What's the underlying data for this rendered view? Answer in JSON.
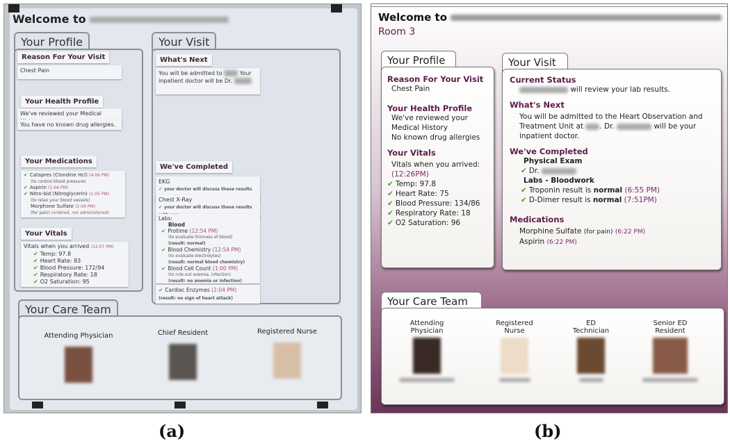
{
  "panel_a": {
    "label": "(a)",
    "welcome": "Welcome to",
    "profile": {
      "tab": "Your Profile",
      "reason_head": "Reason For Your Visit",
      "reason": "Chest Pain",
      "health_head": "Your Health Profile",
      "health": [
        "We've reviewed your Medical History.",
        "You have no known drug allergies."
      ],
      "meds_head": "Your Medications",
      "meds": [
        {
          "name": "Catapres (Clondine Hcl)",
          "time": "(4:06 PM)",
          "note": "(to control blood pressure)",
          "check": true
        },
        {
          "name": "Aspirin",
          "time": "(1:04 PM)",
          "note": "",
          "check": true
        },
        {
          "name": "Nitro-bid (Nitroglycerin)",
          "time": "(1:05 PM)",
          "note": "(to relax your blood vessels)",
          "check": true
        },
        {
          "name": "Morphone Sulfate",
          "time": "(1:04 PM)",
          "note": "(for pain)",
          "status": "(ordered, not administered)",
          "check": false
        }
      ],
      "vitals_head": "Your Vitals",
      "vitals_intro": "Vitals when you arrived",
      "vitals_time": "(12:07 PM)",
      "vitals": [
        "Temp: 97.8",
        "Heart Rate: 83",
        "Blood Pressure: 172/94",
        "Respiratory Rate: 18",
        "O2 Saturation: 95"
      ]
    },
    "visit": {
      "tab": "Your Visit",
      "next_head": "What's Next",
      "next_a": "You will be admitted to",
      "next_b": "Your",
      "next_c": "inpatient doctor will be Dr.",
      "completed_head": "We've Completed",
      "ekg": "EKG",
      "ekg_note": "your doctor will discuss these results with you",
      "xray": "Chest X-Ray",
      "xray_note": "your doctor will discuss these results with you",
      "labs": "Labs:",
      "blood": "Blood",
      "tests": [
        {
          "name": "Protime",
          "time": "(12:54 PM)",
          "note": "(to evaluate thinness of blood)",
          "result": "(result: normal)"
        },
        {
          "name": "Blood Chemistry",
          "time": "(12:54 PM)",
          "note": "(to evaluate electrolytes)",
          "result": "(result: normal blood chemistry)"
        },
        {
          "name": "Blood Cell Count",
          "time": "(1:00 PM)",
          "note": "(to rule out anemia, infection)",
          "result": "(result: no anemia or infection)"
        },
        {
          "name": "Cardiac Enzymes",
          "time": "(2:04 PM)",
          "note": "",
          "result": "(result: no sign of heart attack)"
        }
      ]
    },
    "care_team": {
      "tab": "Your Care Team",
      "roles": [
        "Attending Physician",
        "Chief Resident",
        "Registered Nurse"
      ]
    }
  },
  "panel_b": {
    "label": "(b)",
    "welcome": "Welcome to",
    "room": "Room 3",
    "profile": {
      "tab": "Your Profile",
      "reason_head": "Reason For Your Visit",
      "reason": "Chest Pain",
      "health_head": "Your Health Profile",
      "health_1": "We've reviewed your",
      "health_2": "Medical History",
      "health_3": "No known drug allergies",
      "vitals_head": "Your Vitals",
      "vitals_intro": "Vitals when you arrived:",
      "vitals_time": "(12:26PM)",
      "vitals": [
        "Temp: 97.8",
        "Heart Rate: 75",
        "Blood Pressure: 134/86",
        "Respiratory Rate: 18",
        "O2 Saturation: 96"
      ]
    },
    "visit": {
      "tab": "Your Visit",
      "status_head": "Current Status",
      "status": "will review your lab results.",
      "next_head": "What's Next",
      "next_1": "You will be admitted to the Heart Observation and",
      "next_2a": "Treatment Unit at",
      "next_2b": ". Dr.",
      "next_2c": "will be your",
      "next_3": "inpatient doctor.",
      "completed_head": "We've Completed",
      "exam": "Physical Exam",
      "exam_dr": "Dr.",
      "labs": "Labs - Bloodwork",
      "results": [
        {
          "pre": "Troponin result is",
          "bold": "normal",
          "time": "(6:55 PM)"
        },
        {
          "pre": "D-Dimer result is",
          "bold": "normal",
          "time": "(7:51PM)"
        }
      ],
      "meds_head": "Medications",
      "meds": [
        {
          "name": "Morphine Sulfate",
          "note": "(for pain)",
          "time": "(6:22 PM)"
        },
        {
          "name": "Aspirin",
          "note": "",
          "time": "(6:22 PM)"
        }
      ]
    },
    "care_team": {
      "tab": "Your Care Team",
      "roles": [
        [
          "Attending",
          "Physician"
        ],
        [
          "Registered",
          "Nurse"
        ],
        [
          "ED",
          "Technician"
        ],
        [
          "Senior ED",
          "Resident"
        ]
      ]
    }
  },
  "colors": {
    "accent_purple": "#5e1d4a",
    "time_purple": "#7a2a6a",
    "check_green": "#4a9a2a"
  }
}
